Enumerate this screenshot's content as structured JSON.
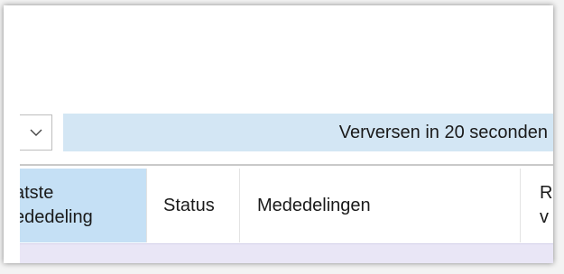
{
  "toolbar": {
    "dropdown_icon": "chevron-down-icon",
    "refresh_text": "Verversen in 20 seconden"
  },
  "table": {
    "columns": [
      {
        "key": "last_message",
        "label": "atste\nededeling",
        "highlighted": true
      },
      {
        "key": "status",
        "label": "Status"
      },
      {
        "key": "messages",
        "label": "Mededelingen"
      },
      {
        "key": "next",
        "label": "R\nv"
      }
    ]
  },
  "colors": {
    "banner_bg": "#d3e6f4",
    "selected_header_bg": "#c5e0f5",
    "row_bg": "#e9e6f6"
  }
}
